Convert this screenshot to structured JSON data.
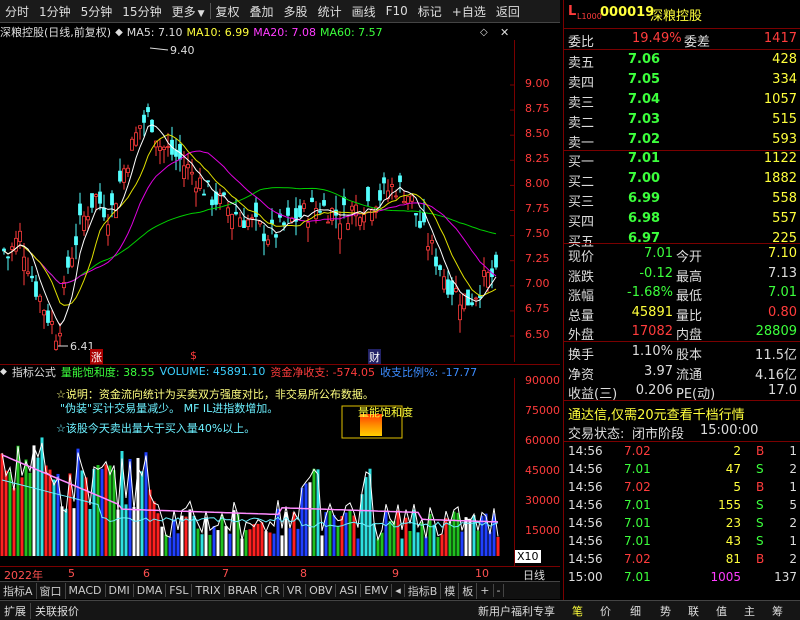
{
  "toolbar": {
    "items": [
      "分时",
      "1分钟",
      "5分钟",
      "15分钟",
      "更多",
      "复权",
      "叠加",
      "多股",
      "统计",
      "画线",
      "F10",
      "标记",
      "+自选",
      "返回"
    ]
  },
  "chart_header": {
    "title": "深粮控股(日线,前复权)",
    "ma5": "MA5: 7.10",
    "ma10": "MA10: 6.99",
    "ma20": "MA20: 7.08",
    "ma60": "MA60: 7.57",
    "colors": {
      "ma5": "#ffffff",
      "ma10": "#ffff00",
      "ma20": "#ff00ff",
      "ma60": "#00ff00"
    }
  },
  "price_axis": [
    "9.00",
    "8.75",
    "8.50",
    "8.25",
    "8.00",
    "7.75",
    "7.50",
    "7.25",
    "7.00",
    "6.75",
    "6.50"
  ],
  "price_marks": {
    "high": "9.40",
    "low": "6.41"
  },
  "event_marks": [
    "涨",
    "$",
    "财"
  ],
  "sub_header": {
    "name": "指标公式",
    "qnbhd": "量能饱和度: 38.55",
    "volume": "VOLUME: 45891.10",
    "fund": "资金净收支: -574.05",
    "ratio": "收支比例%: -17.77"
  },
  "sub_notes": [
    "☆说明：资金流向统计为买卖双方强度对比，非交易所公布数据。",
    "\"伪装\"买计交易量减少。 MF IL进指数增加。",
    "☆该股今天卖出量大于买入量40%以上。"
  ],
  "qnbhd_label": "量能饱和度",
  "vol_axis": [
    "90000",
    "75000",
    "60000",
    "45000",
    "30000",
    "15000"
  ],
  "x10": "X10",
  "date_axis": [
    "2022年",
    "5",
    "6",
    "7",
    "8",
    "9",
    "10"
  ],
  "date_right": "日线",
  "bottom_tabs": [
    "指标A",
    "窗口",
    "MACD",
    "DMI",
    "DMA",
    "FSL",
    "TRIX",
    "BRAR",
    "CR",
    "VR",
    "OBV",
    "ASI",
    "EMV",
    "指标B",
    "模",
    "板",
    "+",
    "-"
  ],
  "bottom_bar": {
    "left": [
      "扩展",
      "关联报价"
    ],
    "center": "新用户福利专享",
    "right": [
      "笔",
      "价",
      "细",
      "势",
      "联",
      "值",
      "主",
      "筹"
    ]
  },
  "quote": {
    "code": "000019",
    "name": "深粮控股",
    "level": "L1000",
    "wb_label": "委比",
    "wb": "19.49%",
    "wc_label": "委差",
    "wc": "1417",
    "asks": [
      {
        "l": "卖五",
        "p": "7.06",
        "v": "428"
      },
      {
        "l": "卖四",
        "p": "7.05",
        "v": "334"
      },
      {
        "l": "卖三",
        "p": "7.04",
        "v": "1057"
      },
      {
        "l": "卖二",
        "p": "7.03",
        "v": "515"
      },
      {
        "l": "卖一",
        "p": "7.02",
        "v": "593"
      }
    ],
    "bids": [
      {
        "l": "买一",
        "p": "7.01",
        "v": "1122"
      },
      {
        "l": "买二",
        "p": "7.00",
        "v": "1882"
      },
      {
        "l": "买三",
        "p": "6.99",
        "v": "558"
      },
      {
        "l": "买四",
        "p": "6.98",
        "v": "557"
      },
      {
        "l": "买五",
        "p": "6.97",
        "v": "225"
      }
    ],
    "stats": [
      {
        "l1": "现价",
        "v1": "7.01",
        "l2": "今开",
        "v2": "7.10"
      },
      {
        "l1": "涨跌",
        "v1": "-0.12",
        "l2": "最高",
        "v2": "7.13"
      },
      {
        "l1": "涨幅",
        "v1": "-1.68%",
        "l2": "最低",
        "v2": "7.01"
      },
      {
        "l1": "总量",
        "v1": "45891",
        "l2": "量比",
        "v2": "0.80"
      },
      {
        "l1": "外盘",
        "v1": "17082",
        "l2": "内盘",
        "v2": "28809"
      }
    ],
    "stats2": [
      {
        "l1": "换手",
        "v1": "1.10%",
        "l2": "股本",
        "v2": "11.5亿"
      },
      {
        "l1": "净资",
        "v1": "3.97",
        "l2": "流通",
        "v2": "4.16亿"
      },
      {
        "l1": "收益(三)",
        "v1": "0.206",
        "l2": "PE(动)",
        "v2": "17.0"
      }
    ],
    "banner": "通达信,仅需20元查看千档行情",
    "status_label": "交易状态:",
    "status": "闭市阶段",
    "status_time": "15:00:00",
    "ticks": [
      {
        "t": "14:56",
        "p": "7.02",
        "v": "2",
        "bs": "B",
        "n": "1"
      },
      {
        "t": "14:56",
        "p": "7.01",
        "v": "47",
        "bs": "S",
        "n": "2"
      },
      {
        "t": "14:56",
        "p": "7.02",
        "v": "5",
        "bs": "B",
        "n": "1"
      },
      {
        "t": "14:56",
        "p": "7.01",
        "v": "155",
        "bs": "S",
        "n": "5"
      },
      {
        "t": "14:56",
        "p": "7.01",
        "v": "23",
        "bs": "S",
        "n": "2"
      },
      {
        "t": "14:56",
        "p": "7.01",
        "v": "43",
        "bs": "S",
        "n": "1"
      },
      {
        "t": "14:56",
        "p": "7.02",
        "v": "81",
        "bs": "B",
        "n": "2"
      },
      {
        "t": "15:00",
        "p": "7.01",
        "v": "1005",
        "bs": "",
        "n": "137"
      }
    ]
  }
}
